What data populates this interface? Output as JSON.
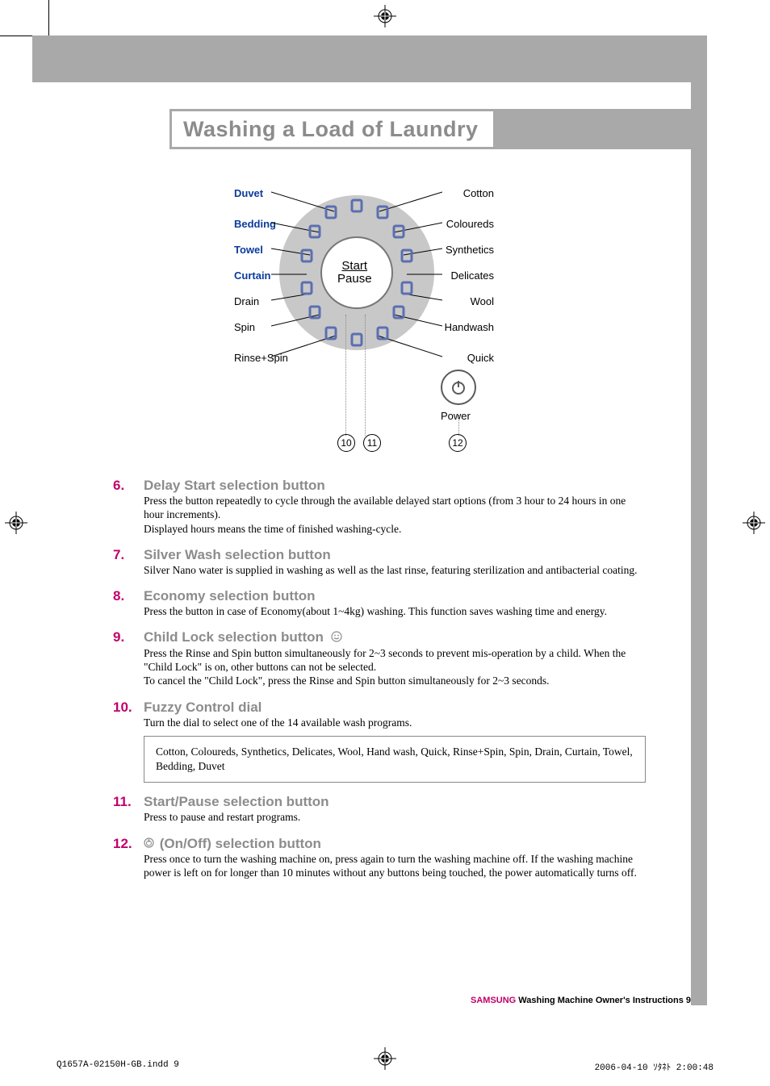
{
  "page": {
    "title": "Washing a Load of Laundry"
  },
  "dial": {
    "left_labels": [
      "Duvet",
      "Bedding",
      "Towel",
      "Curtain",
      "Drain",
      "Spin",
      "Rinse+Spin"
    ],
    "right_labels": [
      "Cotton",
      "Coloureds",
      "Synthetics",
      "Delicates",
      "Wool",
      "Handwash",
      "Quick"
    ],
    "center_top": "Start",
    "center_bottom": "Pause",
    "power_label": "Power",
    "callout_10": "10",
    "callout_11": "11",
    "callout_12": "12"
  },
  "sections": [
    {
      "num": "6.",
      "title": "Delay Start selection button",
      "body": "Press the button repeatedly to cycle through the available delayed start options (from 3 hour to 24 hours in one hour increments).\nDisplayed hours means the time of finished washing-cycle."
    },
    {
      "num": "7.",
      "title": "Silver Wash selection button",
      "body": "Silver Nano water is supplied in washing as well as the last rinse, featuring sterilization and antibacterial coating."
    },
    {
      "num": "8.",
      "title": "Economy selection button",
      "body": "Press the button in case of Economy(about 1~4kg) washing. This function saves washing time and energy."
    },
    {
      "num": "9.",
      "title": "Child Lock selection button",
      "icon": "smiley-icon",
      "body": "Press the Rinse and Spin button simultaneously for 2~3 seconds to prevent mis-operation by a child.  When the \"Child Lock\" is on, other buttons can not be selected.\nTo cancel the \"Child Lock\", press the Rinse and Spin button simultaneously for 2~3 seconds."
    },
    {
      "num": "10.",
      "title": "Fuzzy Control dial",
      "body": "Turn the dial to select one of the 14 available wash programs.",
      "programs": "Cotton, Coloureds, Synthetics, Delicates, Wool, Hand wash, Quick, Rinse+Spin, Spin, Drain, Curtain, Towel, Bedding, Duvet"
    },
    {
      "num": "11.",
      "title": "Start/Pause selection button",
      "body": "Press to pause and restart programs."
    },
    {
      "num": "12.",
      "title": "(On/Off) selection button",
      "icon": "power-icon",
      "icon_before": true,
      "body": "Press once to turn the washing machine on, press again to turn the washing machine off.  If the washing machine power is left on for longer than 10 minutes without any buttons being touched, the power automatically turns off."
    }
  ],
  "footer": {
    "brand": "SAMSUNG",
    "text": " Washing Machine Owner's Instructions  ",
    "page_num": "9"
  },
  "imposition": {
    "file": "Q1657A-02150H-GB.indd   9",
    "timestamp": "2006-04-10   ｿﾀﾈﾄ 2:00:48"
  }
}
